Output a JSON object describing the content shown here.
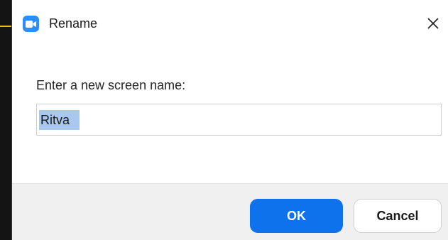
{
  "window": {
    "title": "Rename",
    "app_icon": "video-camera-icon",
    "close_icon": "close-icon"
  },
  "form": {
    "prompt_label": "Enter a new screen name:",
    "name_value": "Ritva",
    "name_selected": true
  },
  "buttons": {
    "ok_label": "OK",
    "cancel_label": "Cancel"
  },
  "colors": {
    "brand": "#2d8cff",
    "primary_button": "#0e72ed",
    "selection": "#a8c8f0",
    "backdrop_accent": "#f2b51a"
  }
}
